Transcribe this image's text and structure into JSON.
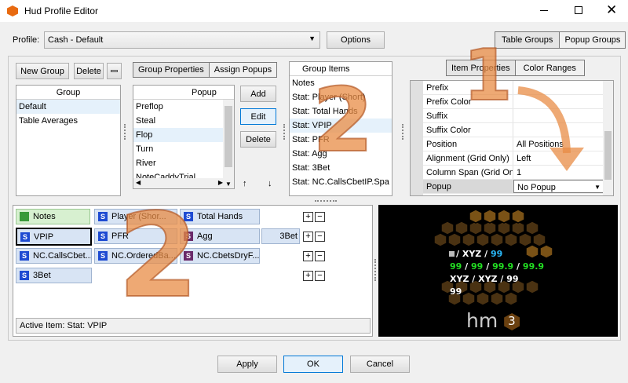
{
  "window": {
    "title": "Hud Profile Editor"
  },
  "profile": {
    "label": "Profile:",
    "value": "Cash - Default",
    "options_label": "Options"
  },
  "groups_tabs": [
    "Table Groups",
    "Popup Groups"
  ],
  "group_panel": {
    "new_group": "New Group",
    "delete": "Delete",
    "header": "Group",
    "items": [
      "Default",
      "Table Averages"
    ]
  },
  "popup_panel": {
    "tabs": [
      "Group Properties",
      "Assign Popups"
    ],
    "header": "Popup",
    "items": [
      "Preflop",
      "Steal",
      "Flop",
      "Turn",
      "River",
      "NoteCaddyTrial"
    ],
    "add": "Add",
    "edit": "Edit",
    "delete": "Delete",
    "up_arrow": "↑",
    "down_arrow": "↓"
  },
  "group_items": {
    "header": "Group Items",
    "items": [
      "Notes",
      "Stat: Player (Short)",
      "Stat: Total Hands",
      "Stat: VPIP",
      "Stat: PFR",
      "Stat: Agg",
      "Stat: 3Bet",
      "Stat: NC.CallsCbetIP.Spa"
    ]
  },
  "item_tabs": [
    "Item Properties",
    "Color Ranges"
  ],
  "properties": [
    {
      "k": "Prefix",
      "v": ""
    },
    {
      "k": "Prefix Color",
      "v": ""
    },
    {
      "k": "Suffix",
      "v": ""
    },
    {
      "k": "Suffix Color",
      "v": ""
    },
    {
      "k": "Position",
      "v": "All Positions"
    },
    {
      "k": "Alignment (Grid Only)",
      "v": "Left"
    },
    {
      "k": "Column Span (Grid Onl",
      "v": "1"
    },
    {
      "k": "Popup",
      "v": "No Popup"
    }
  ],
  "tiles": {
    "r1": [
      "Notes",
      "Player (Shor...",
      "Total Hands"
    ],
    "r2": [
      "VPIP",
      "PFR",
      "Agg",
      "3Bet"
    ],
    "r3": [
      "NC.CallsCbet...",
      "NC.OrderedBa...",
      "NC.CbetsDryF..."
    ],
    "r4": [
      "3Bet"
    ]
  },
  "icons": {
    "s": "S"
  },
  "pm": {
    "plus": "+",
    "minus": "−"
  },
  "active_item": "Active Item: Stat: VPIP",
  "preview": {
    "l1a": "/ XYZ /",
    "l1b": "99",
    "l2": [
      "99",
      "/",
      "99",
      "/",
      "99.9",
      "/",
      "99.9"
    ],
    "l3": "XYZ / XYZ / 99",
    "l4": "99",
    "logo": "hm",
    "logo_num": "3"
  },
  "overlay": {
    "n1": "1",
    "n2": "2",
    "n2b": "2"
  },
  "footer": {
    "apply": "Apply",
    "ok": "OK",
    "cancel": "Cancel"
  },
  "colors": {
    "accent": "#0078d7",
    "preview_bg": "#000000",
    "green": "#22dd22",
    "cyan": "#29b6f6"
  }
}
